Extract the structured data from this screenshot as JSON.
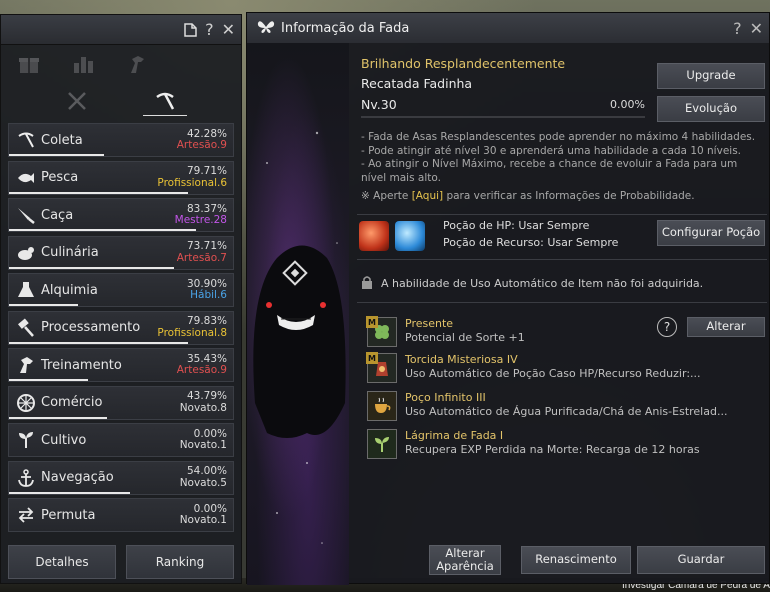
{
  "left_panel": {
    "titlebar_icons": [
      "document-icon",
      "help-icon",
      "close-icon"
    ],
    "category_icons": [
      "gift-icon",
      "bar-chart-icon",
      "horse-icon"
    ],
    "subtabs": [
      {
        "icon": "crossed-swords-icon",
        "active": false
      },
      {
        "icon": "pickaxe-icon",
        "active": true
      }
    ],
    "skills": [
      {
        "icon": "pickaxe-icon",
        "name": "Coleta",
        "pct": "42.28%",
        "rank": "Artesão.9",
        "rank_color": "#e05050",
        "progress": 0.4228
      },
      {
        "icon": "fish-icon",
        "name": "Pesca",
        "pct": "79.71%",
        "rank": "Profissional.6",
        "rank_color": "#e9c235",
        "progress": 0.7971
      },
      {
        "icon": "knife-icon",
        "name": "Caça",
        "pct": "83.37%",
        "rank": "Mestre.28",
        "rank_color": "#c255e8",
        "progress": 0.8337
      },
      {
        "icon": "chicken-icon",
        "name": "Culinária",
        "pct": "73.71%",
        "rank": "Artesão.7",
        "rank_color": "#e05050",
        "progress": 0.7371
      },
      {
        "icon": "flask-icon",
        "name": "Alquimia",
        "pct": "30.90%",
        "rank": "Hábil.6",
        "rank_color": "#4aa3e6",
        "progress": 0.309
      },
      {
        "icon": "hammer-icon",
        "name": "Processamento",
        "pct": "79.83%",
        "rank": "Profissional.8",
        "rank_color": "#e9c235",
        "progress": 0.7983
      },
      {
        "icon": "horse-head-icon",
        "name": "Treinamento",
        "pct": "35.43%",
        "rank": "Artesão.9",
        "rank_color": "#e05050",
        "progress": 0.3543
      },
      {
        "icon": "wheel-icon",
        "name": "Comércio",
        "pct": "43.79%",
        "rank": "Novato.8",
        "rank_color": "#dcdcdc",
        "progress": 0.4379
      },
      {
        "icon": "sprout-icon",
        "name": "Cultivo",
        "pct": "0.00%",
        "rank": "Novato.1",
        "rank_color": "#dcdcdc",
        "progress": 0.0
      },
      {
        "icon": "anchor-icon",
        "name": "Navegação",
        "pct": "54.00%",
        "rank": "Novato.5",
        "rank_color": "#dcdcdc",
        "progress": 0.54
      },
      {
        "icon": "swap-icon",
        "name": "Permuta",
        "pct": "0.00%",
        "rank": "Novato.1",
        "rank_color": "#dcdcdc",
        "progress": 0.0
      }
    ],
    "buttons": {
      "details": "Detalhes",
      "ranking": "Ranking"
    }
  },
  "fairy_panel": {
    "title_icon": "butterfly-icon",
    "title": "Informação da Fada",
    "titlebar_icons": [
      "help-icon",
      "close-icon"
    ],
    "fairy_name": "Brilhando Resplandecentemente",
    "fairy_subtitle": "Recatada Fadinha",
    "level": "Nv.30",
    "exp": "0.00%",
    "exp_progress": 0.0,
    "buttons": {
      "upgrade": "Upgrade",
      "evolution": "Evolução",
      "configure_potion": "Configurar Poção",
      "change": "Alterar",
      "change_appearance_line1": "Alterar",
      "change_appearance_line2": "Aparência",
      "rebirth": "Renascimento",
      "store": "Guardar"
    },
    "description": [
      "- Fada de Asas Resplandescentes pode aprender no máximo 4 habilidades.",
      "- Pode atingir até nível 30 e aprenderá uma habilidade a cada 10 níveis.",
      "- Ao atingir o Nível Máximo, recebe a chance de evoluir a Fada para um nível mais alto."
    ],
    "probability_note": {
      "prefix": "※ Aperte ",
      "link": "[Aqui]",
      "suffix": " para verificar as Informações de Probabilidade."
    },
    "potions": {
      "hp": "Poção de HP: Usar Sempre",
      "resource": "Poção de Recurso: Usar Sempre",
      "hp_icon": "hp-potion-icon",
      "resource_icon": "resource-potion-icon"
    },
    "auto_item": {
      "icon": "lock-icon",
      "text": "A habilidade de Uso Automático de Item não foi adquirida."
    },
    "skills": [
      {
        "icon": "clover-icon",
        "badge": "M",
        "name": "Presente",
        "desc": "Potencial de Sorte +1"
      },
      {
        "icon": "potion-bag-icon",
        "badge": "M",
        "name": "Torcida Misteriosa IV",
        "desc": "Uso Automático de Poção Caso HP/Recurso Reduzir:..."
      },
      {
        "icon": "tea-cup-icon",
        "badge": "",
        "name": "Poço Infinito III",
        "desc": "Uso Automático de Água Purificada/Chá de Anis-Estrelad..."
      },
      {
        "icon": "sprout-icon",
        "badge": "",
        "name": "Lágrima de Fada I",
        "desc": "Recupera EXP Perdida na Morte: Recarga de 12 horas"
      }
    ]
  },
  "background_text": "Investigar Câmara de Pedra de A"
}
